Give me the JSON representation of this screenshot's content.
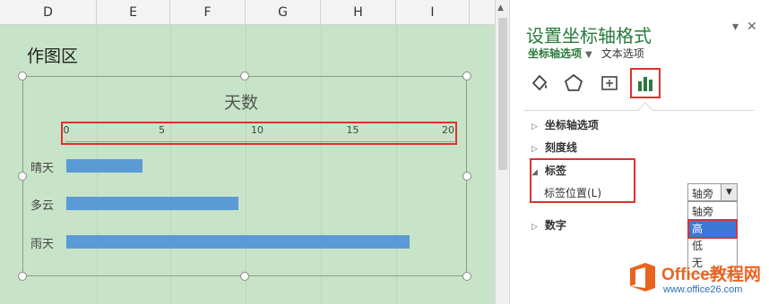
{
  "sheet": {
    "columns": [
      "D",
      "E",
      "F",
      "G",
      "H",
      "I"
    ],
    "area_label": "作图区"
  },
  "chart_data": {
    "type": "bar",
    "title": "天数",
    "categories": [
      "晴天",
      "多云",
      "雨天"
    ],
    "values": [
      4,
      9,
      18
    ],
    "xlim": [
      0,
      20
    ],
    "x_ticks": [
      0,
      5,
      10,
      15,
      20
    ],
    "bar_color": "#5b9bd5",
    "axis_position": "top"
  },
  "pane": {
    "title": "设置坐标轴格式",
    "tab_active": "坐标轴选项",
    "tab_other": "文本选项",
    "icons": [
      "fill-line-icon",
      "effects-pentagon-icon",
      "size-properties-icon",
      "axis-options-chart-icon"
    ],
    "sections": {
      "axis_options": "坐标轴选项",
      "tick_marks": "刻度线",
      "labels": "标签",
      "numbers": "数字"
    },
    "label_position_text": "标签位置(L)",
    "select": {
      "value": "轴旁",
      "options": [
        "轴旁",
        "高",
        "低",
        "无"
      ],
      "highlighted": "高"
    },
    "accent_color": "#2a7a3b",
    "highlight_color": "#e03030"
  },
  "watermark": {
    "brand": "Office教程网",
    "url": "www.office26.com"
  }
}
